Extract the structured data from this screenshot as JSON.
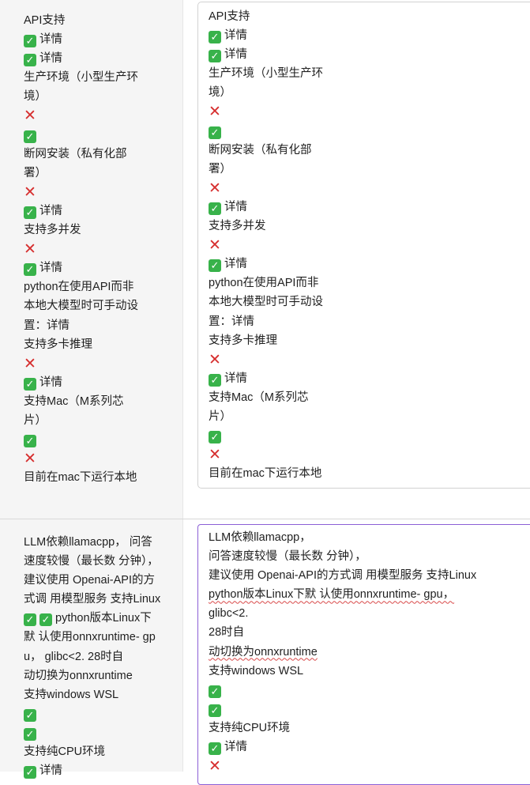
{
  "row1": {
    "left": [
      {
        "text": "API支持"
      },
      {
        "icon": "ok",
        "text": "详情"
      },
      {
        "icon": "ok",
        "text": "详情"
      },
      {
        "text": "生产环境（小型生产环"
      },
      {
        "text": "境）"
      },
      {
        "icon": "no",
        "text": ""
      },
      {
        "icon": "ok",
        "text": ""
      },
      {
        "text": "断网安装（私有化部"
      },
      {
        "text": "署）"
      },
      {
        "icon": "no",
        "text": ""
      },
      {
        "icon": "ok",
        "text": "详情"
      },
      {
        "text": "支持多并发"
      },
      {
        "icon": "no",
        "text": ""
      },
      {
        "icon": "ok",
        "text": "详情"
      },
      {
        "text": "python在使用API而非"
      },
      {
        "text": "本地大模型时可手动设"
      },
      {
        "text": "置：详情"
      },
      {
        "text": "支持多卡推理"
      },
      {
        "icon": "no",
        "text": ""
      },
      {
        "icon": "ok",
        "text": "详情"
      },
      {
        "text": "支持Mac（M系列芯"
      },
      {
        "text": "片）"
      },
      {
        "icon": "ok",
        "text": ""
      },
      {
        "icon": "no",
        "text": ""
      },
      {
        "text": "目前在mac下运行本地"
      }
    ],
    "right": [
      {
        "text": "API支持"
      },
      {
        "icon": "ok",
        "text": "详情"
      },
      {
        "icon": "ok",
        "text": "详情"
      },
      {
        "text": "生产环境（小型生产环"
      },
      {
        "text": "境）"
      },
      {
        "icon": "no",
        "text": ""
      },
      {
        "icon": "ok",
        "text": ""
      },
      {
        "text": "断网安装（私有化部"
      },
      {
        "text": "署）"
      },
      {
        "icon": "no",
        "text": ""
      },
      {
        "icon": "ok",
        "text": "详情"
      },
      {
        "text": "支持多并发"
      },
      {
        "icon": "no",
        "text": ""
      },
      {
        "icon": "ok",
        "text": "详情"
      },
      {
        "text": "python在使用API而非"
      },
      {
        "text": "本地大模型时可手动设"
      },
      {
        "text": "置：详情"
      },
      {
        "text": "支持多卡推理"
      },
      {
        "icon": "no",
        "text": ""
      },
      {
        "icon": "ok",
        "text": "详情"
      },
      {
        "text": "支持Mac（M系列芯"
      },
      {
        "text": "片）"
      },
      {
        "icon": "ok",
        "text": ""
      },
      {
        "icon": "no",
        "text": ""
      },
      {
        "text": "目前在mac下运行本地"
      }
    ]
  },
  "row2": {
    "left": [
      {
        "text": "LLM依赖llamacpp， 问答"
      },
      {
        "text": "速度较慢（最长数 分钟），"
      },
      {
        "text": "建议使用 Openai-API的方"
      },
      {
        "text": "式调 用模型服务 支持Linux"
      },
      {
        "icons": 2,
        "text": "python版本Linux下"
      },
      {
        "text": "默 认使用onnxruntime- gp"
      },
      {
        "text": "u，  glibc<2. 28时自"
      },
      {
        "text": "动切换为onnxruntime"
      },
      {
        "text": "支持windows WSL"
      },
      {
        "icon": "ok",
        "text": ""
      },
      {
        "icon": "ok",
        "text": ""
      },
      {
        "text": "支持纯CPU环境"
      },
      {
        "icon": "ok",
        "text": "详情"
      }
    ],
    "right": [
      {
        "text": "LLM依赖llamacpp，"
      },
      {
        "text": "  问答速度较慢（最长数  分钟），"
      },
      {
        "text": "建议使用  Openai-API的方式调  用模型服务  支持Linux"
      },
      {
        "text": "python版本Linux下默  认使用onnxruntime-  gpu，"
      },
      {
        "text": "glibc<2."
      },
      {
        "text": "28时自"
      },
      {
        "text": "动切换为onnxruntime"
      },
      {
        "text": "支持windows WSL"
      },
      {
        "icon": "ok",
        "text": ""
      },
      {
        "icon": "ok",
        "text": ""
      },
      {
        "text": "支持纯CPU环境"
      },
      {
        "icon": "ok",
        "text": "详情"
      },
      {
        "icon": "no",
        "text": ""
      }
    ]
  }
}
